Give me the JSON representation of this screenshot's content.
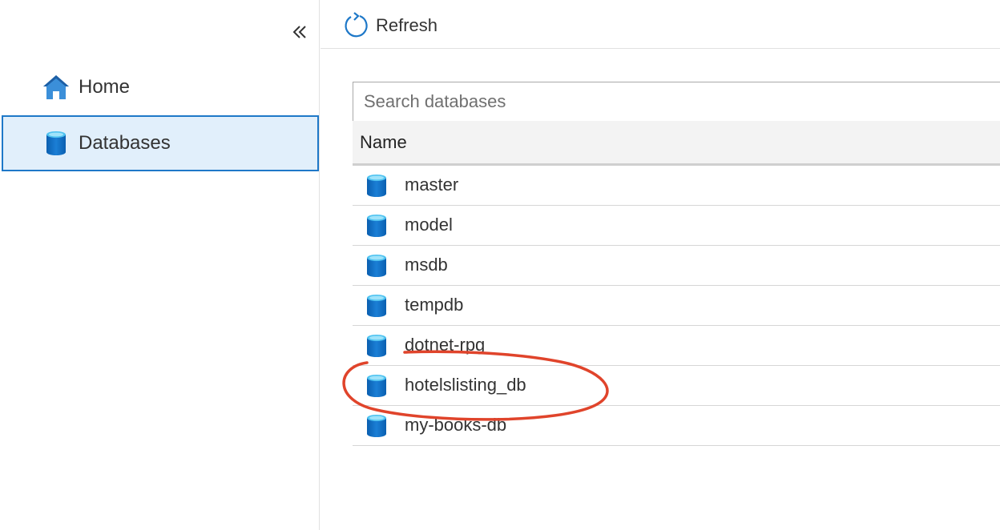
{
  "sidebar": {
    "collapse_icon": "chevron-double-left-icon",
    "items": [
      {
        "label": "Home",
        "icon": "home-icon",
        "selected": false
      },
      {
        "label": "Databases",
        "icon": "database-icon",
        "selected": true
      }
    ]
  },
  "toolbar": {
    "refresh_label": "Refresh",
    "refresh_icon": "refresh-icon"
  },
  "search": {
    "placeholder": "Search databases",
    "value": ""
  },
  "table": {
    "columns": [
      "Name"
    ],
    "rows": [
      {
        "name": "master"
      },
      {
        "name": "model"
      },
      {
        "name": "msdb"
      },
      {
        "name": "tempdb"
      },
      {
        "name": "dotnet-rpg"
      },
      {
        "name": "hotelslisting_db"
      },
      {
        "name": "my-books-db"
      }
    ]
  },
  "colors": {
    "accent": "#1e78c8",
    "selected_bg": "#e1effb",
    "annotation": "#e0442b"
  }
}
